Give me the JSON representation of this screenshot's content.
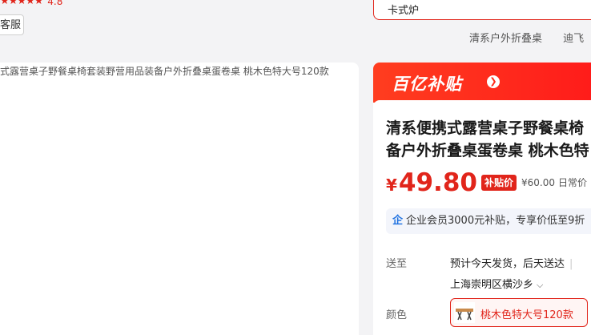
{
  "rating": {
    "score": "4.8",
    "stars": 5
  },
  "service_button": "客服",
  "search": {
    "value": "卡式炉"
  },
  "hot_links": [
    "清系户外折叠桌",
    "迪飞"
  ],
  "left_caption": "式露营桌子野餐桌椅套装野营用品装备户外折叠桌蛋卷桌 桃木色特大号120款",
  "subsidy": {
    "title": "百亿补贴"
  },
  "product": {
    "title_line1": "清系便携式露营桌子野餐桌椅",
    "title_line2": "备户外折叠桌蛋卷桌 桃木色特",
    "currency": "¥",
    "price": "49.80",
    "price_tag": "补贴价",
    "original_price": "¥60.00",
    "original_label": "日常价",
    "member_text": "企业会员3000元补贴，专享价低至9折"
  },
  "delivery": {
    "label": "送至",
    "schedule": "预计今天发货，后天送达",
    "address": "上海崇明区横沙乡"
  },
  "color": {
    "label": "颜色",
    "option": "桃木色特大号120款"
  },
  "colors": {
    "accent": "#e1251b",
    "member_icon": "#1b6fe0"
  }
}
